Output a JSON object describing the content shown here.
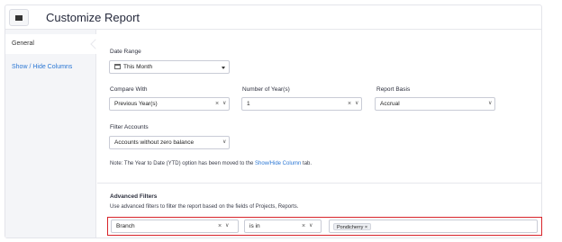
{
  "header": {
    "title": "Customize Report"
  },
  "sidebar": {
    "items": [
      {
        "label": "General"
      },
      {
        "label": "Show / Hide Columns"
      }
    ]
  },
  "date_range": {
    "label": "Date Range",
    "value": "This Month"
  },
  "compare_with": {
    "label": "Compare With",
    "value": "Previous Year(s)"
  },
  "number_of_years": {
    "label": "Number of Year(s)",
    "value": "1"
  },
  "report_basis": {
    "label": "Report Basis",
    "value": "Accrual"
  },
  "filter_accounts": {
    "label": "Filter Accounts",
    "value": "Accounts without zero balance"
  },
  "note": {
    "prefix": "Note: The Year to Date (YTD) option has been moved to the ",
    "link": "Show/Hide Column",
    "suffix": " tab."
  },
  "advanced_filters": {
    "title": "Advanced Filters",
    "description": "Use advanced filters to filter the report based on the fields of Projects, Reports.",
    "field": "Branch",
    "operator": "is in",
    "values": [
      "Pondicherry"
    ]
  },
  "colors": {
    "link": "#2b77d4",
    "highlight_border": "#d8232a",
    "sidebar_bg": "#f4f5f8"
  }
}
